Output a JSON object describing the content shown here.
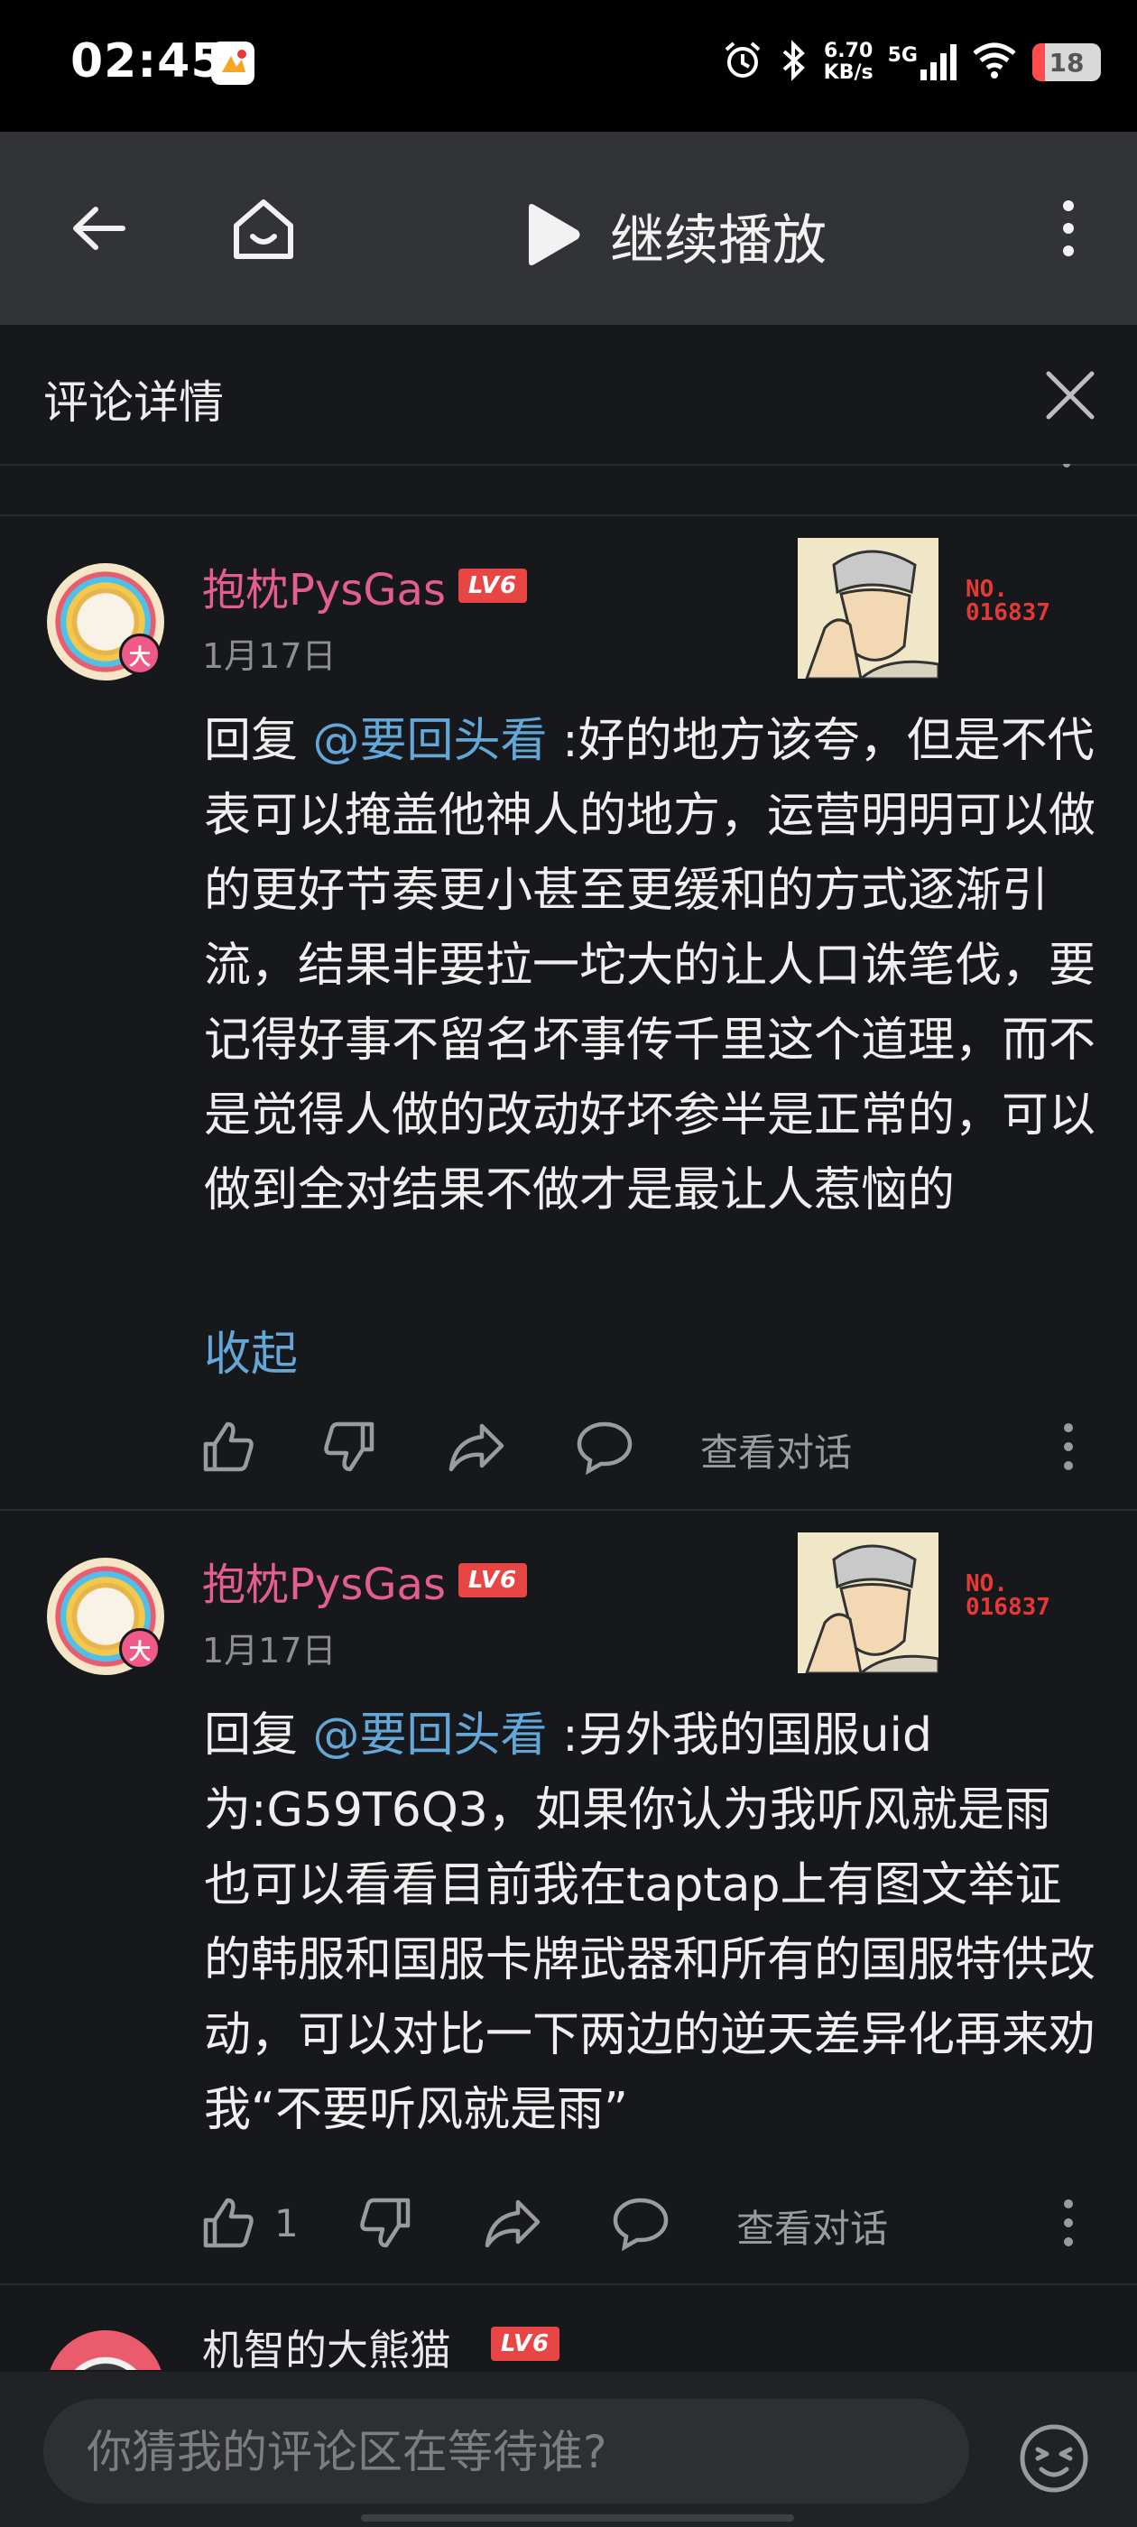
{
  "status_bar": {
    "time": "02:45",
    "net_speed_value": "6.70",
    "net_speed_unit": "KB/s",
    "network": "5G",
    "battery": "18",
    "battery_level": 0.18,
    "icons": [
      "notification-app-icon",
      "alarm-icon",
      "bluetooth-icon",
      "signal-icon",
      "wifi-icon",
      "battery-icon"
    ]
  },
  "top_bar": {
    "continue_play_label": "继续播放",
    "icons": [
      "back-arrow-icon",
      "home-icon",
      "play-icon",
      "more-vert-icon"
    ]
  },
  "panel": {
    "title": "评论详情",
    "close_icon": "close-icon"
  },
  "comments": [
    {
      "username": "抱枕PysGas",
      "level": "LV6",
      "avatar_badge": "大",
      "date": "1月17日",
      "decoration_no": "NO.",
      "decoration_number": "016837",
      "reply_prefix": "回复 ",
      "mention": "@要回头看",
      "text": " :好的地方该夸，但是不代表可以掩盖他神人的地方，运营明明可以做的更好节奏更小甚至更缓和的方式逐渐引流，结果非要拉一坨大的让人口诛笔伐，要记得好事不留名坏事传千里这个道理，而不是觉得人做的改动好坏参半是正常的，可以做到全对结果不做才是最让人惹恼的",
      "collapse_label": "收起",
      "like_count": "",
      "view_dialog_label": "查看对话"
    },
    {
      "username": "抱枕PysGas",
      "level": "LV6",
      "avatar_badge": "大",
      "date": "1月17日",
      "decoration_no": "NO.",
      "decoration_number": "016837",
      "reply_prefix": "回复 ",
      "mention": "@要回头看",
      "text": " :另外我的国服uid为:G59T6Q3，如果你认为我听风就是雨也可以看看目前我在taptap上有图文举证的韩服和国服卡牌武器和所有的国服特供改动，可以对比一下两边的逆天差异化再来劝我“不要听风就是雨”",
      "like_count": "1",
      "view_dialog_label": "查看对话"
    }
  ],
  "partial_comment": {
    "username": "机智的大熊猫",
    "level": "LV6"
  },
  "bottom_bar": {
    "input_placeholder": "你猜我的评论区在等待谁?",
    "emoji_icon": "emoji-icon"
  },
  "colors": {
    "background": "#17181c",
    "top_bar": "#323336",
    "username": "#e45e8d",
    "mention_link": "#63a7d8",
    "level_badge": "#e84545",
    "muted_text": "#8d8e93"
  }
}
